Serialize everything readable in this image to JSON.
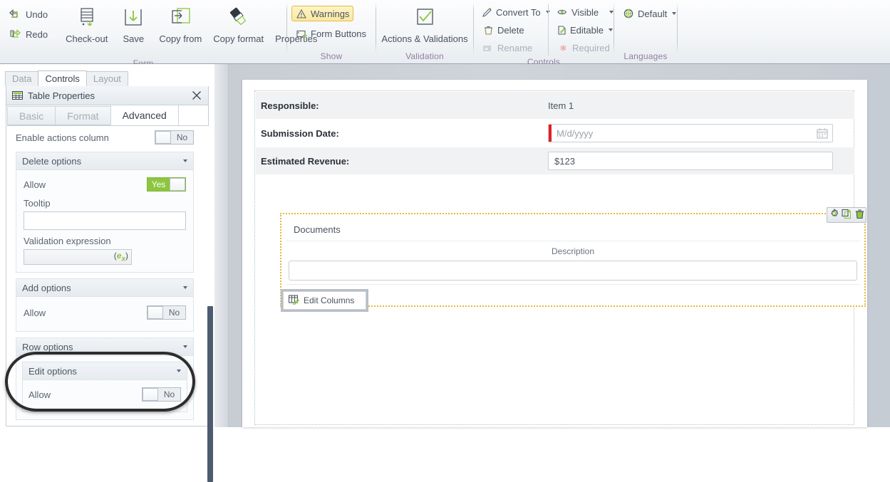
{
  "ribbon": {
    "groups": [
      {
        "label": "Form",
        "small_commands": [
          {
            "label": "Undo",
            "icon": "undo-icon"
          },
          {
            "label": "Redo",
            "icon": "redo-icon"
          }
        ],
        "big_commands": [
          {
            "label": "Check-out",
            "icon": "check-out-icon"
          },
          {
            "label": "Save",
            "icon": "save-icon"
          },
          {
            "label": "Copy from",
            "icon": "copy-from-icon"
          },
          {
            "label": "Copy format",
            "icon": "copy-format-icon"
          },
          {
            "label": "Properties",
            "icon": "gear-icon"
          }
        ]
      },
      {
        "label": "Show",
        "items": [
          {
            "label": "Warnings",
            "icon": "warning-icon",
            "selected": true,
            "disabled": false
          },
          {
            "label": "Form Buttons",
            "icon": "form-buttons-icon",
            "selected": false,
            "disabled": false
          }
        ]
      },
      {
        "label": "Validation",
        "big_commands": [
          {
            "label": "Actions & Validations",
            "icon": "checkmark-box-icon"
          }
        ]
      },
      {
        "label": "Controls",
        "column_a": [
          {
            "label": "Convert To",
            "icon": "convert-to-icon",
            "dropdown": true,
            "disabled": false
          },
          {
            "label": "Delete",
            "icon": "trash-icon",
            "dropdown": false,
            "disabled": false
          },
          {
            "label": "Rename",
            "icon": "rename-icon",
            "dropdown": false,
            "disabled": true
          }
        ],
        "column_b": [
          {
            "label": "Visible",
            "icon": "eye-icon",
            "dropdown": true,
            "disabled": false
          },
          {
            "label": "Editable",
            "icon": "editable-icon",
            "dropdown": true,
            "disabled": false
          },
          {
            "label": "Required",
            "icon": "asterisk-icon",
            "dropdown": false,
            "disabled": true
          }
        ]
      },
      {
        "label": "Languages",
        "items": [
          {
            "label": "Default",
            "icon": "globe-icon",
            "dropdown": true
          }
        ]
      }
    ]
  },
  "left_panel": {
    "tabs": [
      {
        "label": "Data",
        "active": false
      },
      {
        "label": "Controls",
        "active": true
      },
      {
        "label": "Layout",
        "active": false
      }
    ],
    "properties": {
      "title": "Table Properties",
      "title_icon": "table-icon",
      "close_icon": "close-icon",
      "sub_tabs": [
        {
          "label": "Basic",
          "active": false
        },
        {
          "label": "Format",
          "active": false
        },
        {
          "label": "Advanced",
          "active": true
        }
      ],
      "enable_actions_column": {
        "label": "Enable actions column",
        "value": "No",
        "on": false
      },
      "delete_options": {
        "header": "Delete options",
        "allow_label": "Allow",
        "allow_value": "Yes",
        "allow_on": true,
        "tooltip_label": "Tooltip",
        "tooltip_value": "",
        "validation_label": "Validation expression",
        "validation_value": "",
        "expression_glyph": "(ex)"
      },
      "add_options": {
        "header": "Add options",
        "allow_label": "Allow",
        "allow_value": "No",
        "allow_on": false,
        "highlighted": true
      },
      "row_options": {
        "header": "Row options",
        "edit_options": {
          "header": "Edit options",
          "allow_label": "Allow",
          "allow_value": "No",
          "allow_on": false
        }
      }
    }
  },
  "canvas": {
    "fields": [
      {
        "label": "Responsible:",
        "type": "static",
        "value": "Item 1",
        "alt_background": true
      },
      {
        "label": "Submission Date:",
        "type": "date",
        "value": "",
        "placeholder": "M/d/yyyy",
        "required": true,
        "icon": "calendar-icon",
        "alt_background": false
      },
      {
        "label": "Estimated Revenue:",
        "type": "text",
        "value": "$123",
        "alt_background": true
      }
    ],
    "table_widget": {
      "title": "Documents",
      "columns": [
        "Description"
      ],
      "rows": [
        [
          ""
        ]
      ],
      "toolbar_icons": [
        "gear-icon",
        "duplicate-icon",
        "trash-icon"
      ],
      "edit_columns_button": {
        "label": "Edit Columns",
        "icon": "edit-columns-icon"
      }
    }
  },
  "colors": {
    "accent_green": "#8cc63f",
    "warning_yellow": "#fbe9a0",
    "required_red": "#e02020",
    "selection_dotted": "#e8b63c",
    "ribbon_group_label": "#8f7f9e"
  }
}
